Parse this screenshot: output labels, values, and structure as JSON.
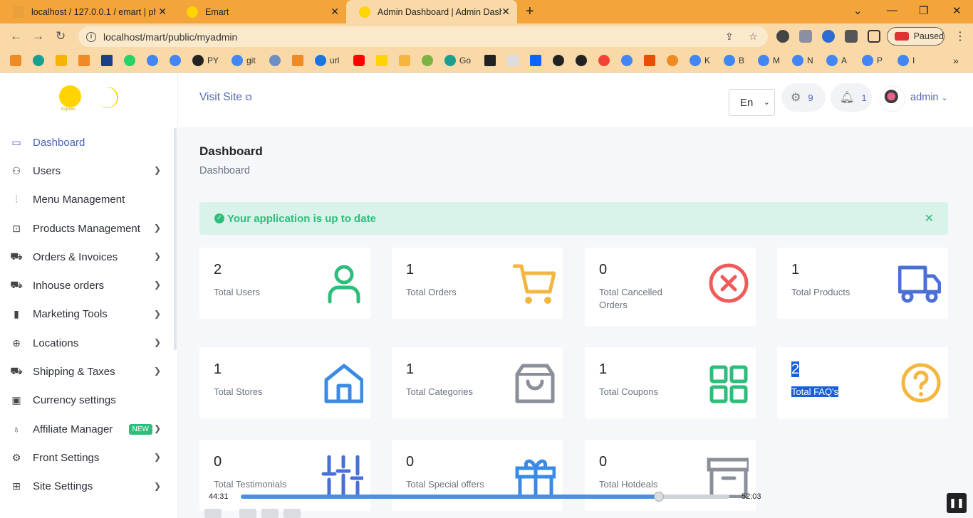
{
  "browser": {
    "tabs": [
      {
        "title": "localhost / 127.0.0.1 / emart | php",
        "favicon_color": "#e8a03c"
      },
      {
        "title": "Emart",
        "favicon_color": "#ffd400"
      },
      {
        "title": "Admin Dashboard | Admin Dashb",
        "favicon_color": "#ffd400",
        "active": true
      }
    ],
    "url": "localhost/mart/public/myadmin",
    "profile_status": "Paused",
    "bookmarks": [
      {
        "label": "PY",
        "color": "#222"
      },
      {
        "label": "git",
        "color": "#4285f4"
      },
      {
        "label": "url",
        "color": "#1a73e8"
      },
      {
        "label": "Go",
        "color": "#1a9e8f"
      },
      {
        "label": "K",
        "color": "#4285f4"
      },
      {
        "label": "B",
        "color": "#4285f4"
      },
      {
        "label": "M",
        "color": "#4285f4"
      },
      {
        "label": "N",
        "color": "#4285f4"
      },
      {
        "label": "A",
        "color": "#4285f4"
      },
      {
        "label": "P",
        "color": "#4285f4"
      },
      {
        "label": "I",
        "color": "#4285f4"
      }
    ]
  },
  "brand": {
    "tagline": "Explore"
  },
  "sidebar": {
    "items": [
      {
        "label": "Dashboard",
        "icon": "monitor-icon",
        "glyph": "▭",
        "active": true,
        "chevron": false
      },
      {
        "label": "Users",
        "icon": "users-icon",
        "glyph": "⚇",
        "chevron": true
      },
      {
        "label": "Menu Management",
        "icon": "sliders-icon",
        "glyph": "⫶",
        "chevron": false
      },
      {
        "label": "Products Management",
        "icon": "bag-icon",
        "glyph": "⊡",
        "chevron": true
      },
      {
        "label": "Orders & Invoices",
        "icon": "cart-icon",
        "glyph": "⛟",
        "chevron": true
      },
      {
        "label": "Inhouse orders",
        "icon": "cart-icon",
        "glyph": "⛟",
        "chevron": true
      },
      {
        "label": "Marketing Tools",
        "icon": "bar-chart-icon",
        "glyph": "▮",
        "chevron": true
      },
      {
        "label": "Locations",
        "icon": "globe-icon",
        "glyph": "⊕",
        "chevron": true
      },
      {
        "label": "Shipping & Taxes",
        "icon": "truck-icon",
        "glyph": "⛟",
        "chevron": true
      },
      {
        "label": "Currency settings",
        "icon": "money-icon",
        "glyph": "▣",
        "chevron": false
      },
      {
        "label": "Affiliate Manager",
        "icon": "award-icon",
        "glyph": "♁",
        "chevron": true,
        "badge": "NEW"
      },
      {
        "label": "Front Settings",
        "icon": "gear-icon",
        "glyph": "⚙",
        "chevron": true
      },
      {
        "label": "Site Settings",
        "icon": "grid-icon",
        "glyph": "⊞",
        "chevron": true
      }
    ]
  },
  "topbar": {
    "visit_site": "Visit Site",
    "language": "En",
    "settings_count": "9",
    "notifications_count": "1",
    "username": "admin"
  },
  "page": {
    "title": "Dashboard",
    "breadcrumb": "Dashboard",
    "alert": "Your application is up to date"
  },
  "stats": [
    {
      "value": "2",
      "label": "Total Users",
      "icon": "user-icon",
      "color": "#2ebd7b"
    },
    {
      "value": "1",
      "label": "Total Orders",
      "icon": "cart-icon",
      "color": "#f4b63f"
    },
    {
      "value": "0",
      "label": "Total Cancelled Orders",
      "icon": "x-circle-icon",
      "color": "#ef5b5b"
    },
    {
      "value": "1",
      "label": "Total Products",
      "icon": "truck-icon",
      "color": "#4a6fd6"
    },
    {
      "value": "1",
      "label": "Total Stores",
      "icon": "home-icon",
      "color": "#3b8be5"
    },
    {
      "value": "1",
      "label": "Total Categories",
      "icon": "shopping-bag-icon",
      "color": "#8a8f99"
    },
    {
      "value": "1",
      "label": "Total Coupons",
      "icon": "grid-icon",
      "color": "#2ebd7b"
    },
    {
      "value": "2",
      "label": "Total FAQ's",
      "icon": "help-circle-icon",
      "color": "#f4b63f",
      "selected": true
    },
    {
      "value": "0",
      "label": "Total Testimonials",
      "icon": "sliders-icon",
      "color": "#4a6fd6"
    },
    {
      "value": "0",
      "label": "Total Special offers",
      "icon": "gift-icon",
      "color": "#3b8be5"
    },
    {
      "value": "0",
      "label": "Total Hotdeals",
      "icon": "archive-icon",
      "color": "#8a8f99"
    }
  ],
  "player": {
    "elapsed": "44:31",
    "duration": "52:03",
    "progress": 0.855
  }
}
